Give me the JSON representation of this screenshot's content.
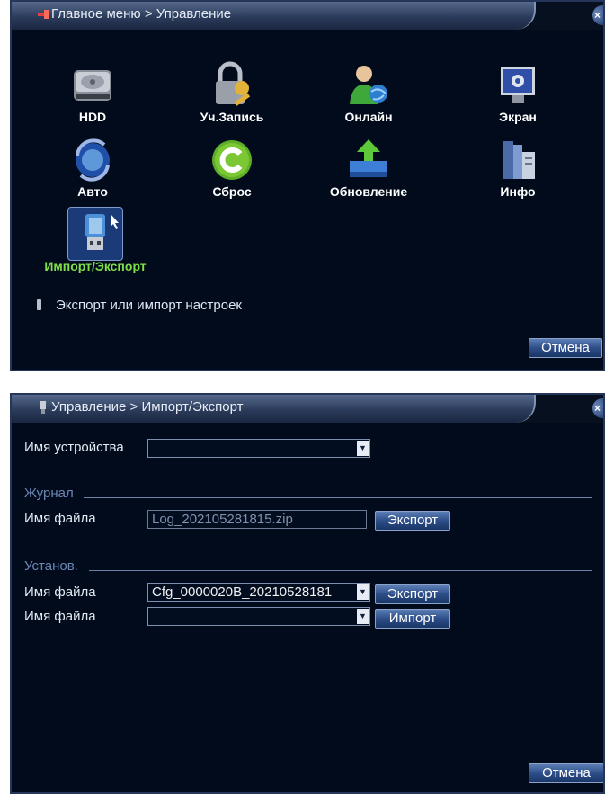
{
  "top_panel": {
    "title": "Главное меню > Управление",
    "items": [
      {
        "label": "HDD",
        "icon": "hard-drive-icon"
      },
      {
        "label": "Уч.Запись",
        "icon": "lock-key-icon"
      },
      {
        "label": "Онлайн",
        "icon": "user-globe-icon"
      },
      {
        "label": "Экран",
        "icon": "monitor-gear-icon"
      },
      {
        "label": "Авто",
        "icon": "auto-maintain-icon"
      },
      {
        "label": "Сброс",
        "icon": "reset-icon"
      },
      {
        "label": "Обновление",
        "icon": "upgrade-arrow-icon"
      },
      {
        "label": "Инфо",
        "icon": "info-books-icon"
      },
      {
        "label": "Импорт/Экспорт",
        "icon": "usb-drive-icon",
        "selected": true
      }
    ],
    "hint": "Экспорт или импорт настроек",
    "cancel_label": "Отмена"
  },
  "bottom_panel": {
    "title": "Управление > Импорт/Экспорт",
    "device_label": "Имя устройства",
    "device_value": "",
    "journal": {
      "section_label": "Журнал",
      "file_label": "Имя файла",
      "file_value": "Log_202105281815.zip",
      "export_label": "Экспорт"
    },
    "settings": {
      "section_label": "Установ.",
      "rows": [
        {
          "file_label": "Имя файла",
          "file_value": "Cfg_0000020B_20210528181",
          "button_label": "Экспорт"
        },
        {
          "file_label": "Имя файла",
          "file_value": "",
          "button_label": "Импорт"
        }
      ]
    },
    "cancel_label": "Отмена"
  },
  "colors": {
    "panel_bg": "#020b1c",
    "selected_label": "#7ee048",
    "section_label": "#6b87b6"
  }
}
